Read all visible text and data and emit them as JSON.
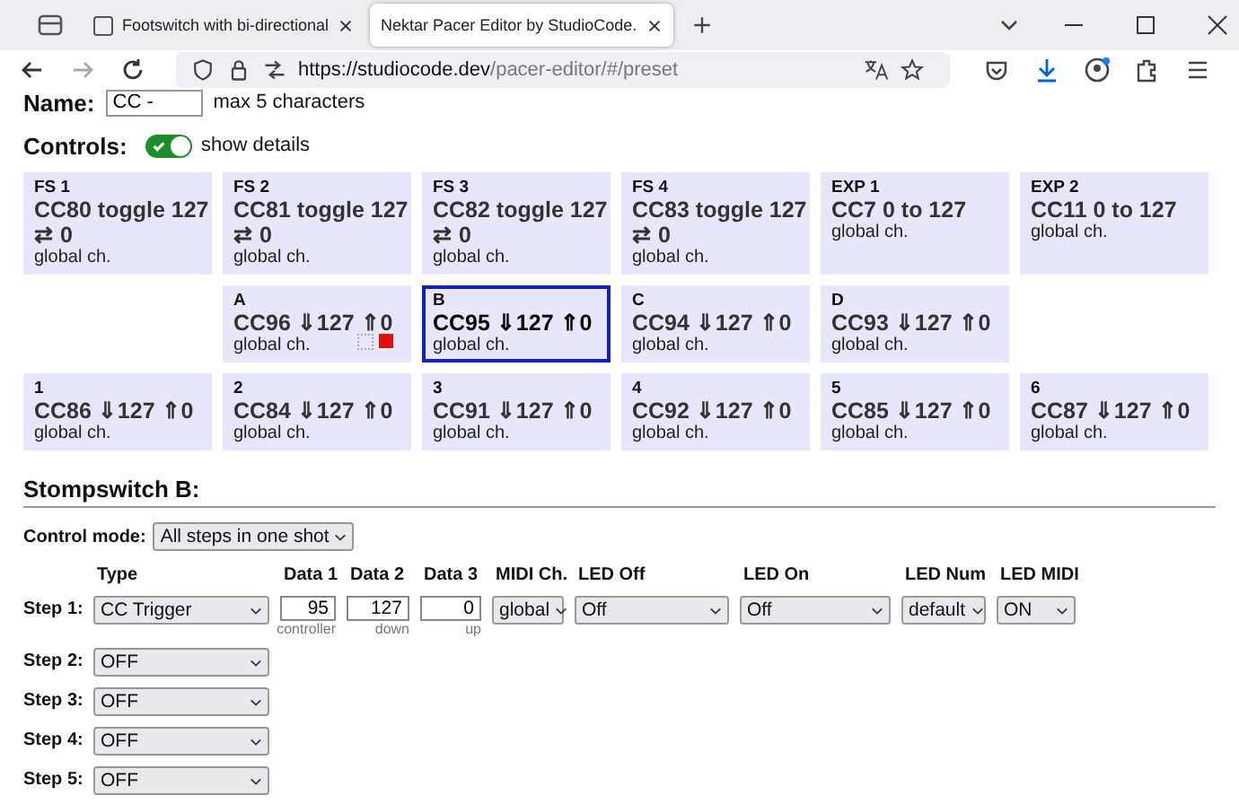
{
  "browser": {
    "tabs": [
      {
        "title": "Footswitch with bi-directional",
        "selected": false
      },
      {
        "title": "Nektar Pacer Editor by StudioCode.",
        "selected": true
      }
    ],
    "url": {
      "host": "https://studiocode.dev",
      "path": "/pacer-editor/#/preset"
    }
  },
  "name_field": {
    "label": "Name:",
    "value": "CC -",
    "hint": "max 5 characters"
  },
  "controls": {
    "label": "Controls:",
    "toggle": {
      "label": "show details",
      "on": true
    },
    "rows": [
      [
        {
          "label": "FS 1",
          "main": "CC80 toggle 127",
          "extra": "⇄ 0",
          "channel": "global ch.",
          "selected": false
        },
        {
          "label": "FS 2",
          "main": "CC81 toggle 127",
          "extra": "⇄ 0",
          "channel": "global ch.",
          "selected": false
        },
        {
          "label": "FS 3",
          "main": "CC82 toggle 127",
          "extra": "⇄ 0",
          "channel": "global ch.",
          "selected": false
        },
        {
          "label": "FS 4",
          "main": "CC83 toggle 127",
          "extra": "⇄ 0",
          "channel": "global ch.",
          "selected": false
        },
        {
          "label": "EXP 1",
          "main": "CC7 0 to 127",
          "channel": "global ch.",
          "selected": false
        },
        {
          "label": "EXP 2",
          "main": "CC11 0 to 127",
          "channel": "global ch.",
          "selected": false
        }
      ],
      [
        "",
        {
          "label": "A",
          "main": "CC96 ⇓127 ⇑0",
          "channel": "global ch.",
          "selected": false,
          "led": true
        },
        {
          "label": "B",
          "main": "CC95 ⇓127 ⇑0",
          "channel": "global ch.",
          "selected": true
        },
        {
          "label": "C",
          "main": "CC94 ⇓127 ⇑0",
          "channel": "global ch.",
          "selected": false
        },
        {
          "label": "D",
          "main": "CC93 ⇓127 ⇑0",
          "channel": "global ch.",
          "selected": false
        },
        ""
      ],
      [
        {
          "label": "1",
          "main": "CC86 ⇓127 ⇑0",
          "channel": "global ch.",
          "selected": false
        },
        {
          "label": "2",
          "main": "CC84 ⇓127 ⇑0",
          "channel": "global ch.",
          "selected": false
        },
        {
          "label": "3",
          "main": "CC91 ⇓127 ⇑0",
          "channel": "global ch.",
          "selected": false
        },
        {
          "label": "4",
          "main": "CC92 ⇓127 ⇑0",
          "channel": "global ch.",
          "selected": false
        },
        {
          "label": "5",
          "main": "CC85 ⇓127 ⇑0",
          "channel": "global ch.",
          "selected": false
        },
        {
          "label": "6",
          "main": "CC87 ⇓127 ⇑0",
          "channel": "global ch.",
          "selected": false
        }
      ]
    ]
  },
  "stompswitch": {
    "title": "Stompswitch B:",
    "control_mode": {
      "label": "Control mode:",
      "value": "All steps in one shot"
    },
    "columns": [
      "Type",
      "Data 1",
      "Data 2",
      "Data 3",
      "MIDI Ch.",
      "LED Off",
      "LED On",
      "LED Num",
      "LED MIDI"
    ],
    "steps": [
      {
        "label": "Step 1:",
        "type": "CC Trigger",
        "data": [
          {
            "value": "95",
            "hint": "controller"
          },
          {
            "value": "127",
            "hint": "down"
          },
          {
            "value": "0",
            "hint": "up"
          }
        ],
        "midi_ch": "global",
        "led_off": "Off",
        "led_on": "Off",
        "led_num": "default",
        "led_midi": "ON"
      },
      {
        "label": "Step 2:",
        "type": "OFF"
      },
      {
        "label": "Step 3:",
        "type": "OFF"
      },
      {
        "label": "Step 4:",
        "type": "OFF"
      },
      {
        "label": "Step 5:",
        "type": "OFF"
      }
    ]
  }
}
